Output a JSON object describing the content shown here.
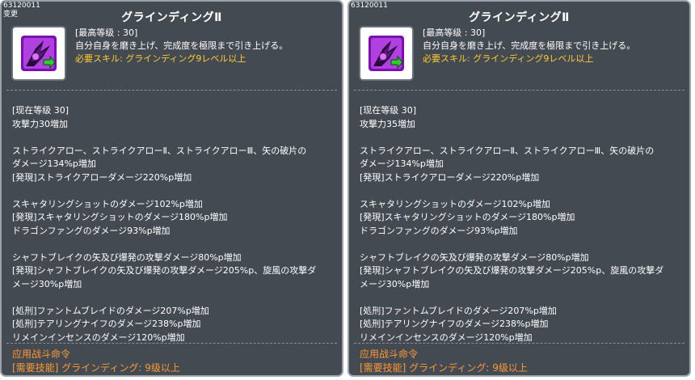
{
  "left": {
    "id": "63120011",
    "changed_label": "变更",
    "title": "グラインディングⅡ",
    "max_level": "[最高等级 : 30]",
    "description": "自分自身を磨き上げ、完成度を極限まで引き上げる。",
    "required_skill": "必要スキル: グラインディング9レベル以上",
    "lines": [
      "[现在等级 30]",
      "攻撃力30増加",
      "",
      "ストライクアロー、ストライクアローⅡ、ストライクアローⅢ、矢の破片の",
      "ダメージ134%p増加",
      "[発現]ストライクアローダメージ220%p増加",
      "",
      "スキャタリングショットのダメージ102%p増加",
      "[発現]スキャタリングショットのダメージ180%p増加",
      "ドラゴンファングのダメージ93%p増加",
      "",
      "シャフトブレイクの矢及び爆発の攻撃ダメージ80%p増加",
      "[発現]シャフトブレイクの矢及び爆発の攻撃ダメージ205%p、旋風の攻撃ダ",
      "メージ30%p増加",
      "",
      "[処刑]ファントムブレイドのダメージ207%p増加",
      "[処刑]テアリングナイフのダメージ238%p増加",
      "リメインインセンスのダメージ120%p増加"
    ],
    "footer_title": "应用战斗命令",
    "footer_req": "[需要技能] グラインディング: 9级以上"
  },
  "right": {
    "id": "63120011",
    "title": "グラインディングⅡ",
    "max_level": "[最高等级 : 30]",
    "description": "自分自身を磨き上げ、完成度を極限まで引き上げる。",
    "required_skill": "必要スキル: グラインディング9レベル以上",
    "lines": [
      "[现在等级 30]",
      "攻撃力35増加",
      "",
      "ストライクアロー、ストライクアローⅡ、ストライクアローⅢ、矢の破片の",
      "ダメージ134%p増加",
      "[発現]ストライクアローダメージ220%p増加",
      "",
      "スキャタリングショットのダメージ102%p増加",
      "[発現]スキャタリングショットのダメージ180%p増加",
      "ドラゴンファングのダメージ93%p増加",
      "",
      "シャフトブレイクの矢及び爆発の攻撃ダメージ80%p増加",
      "[発現]シャフトブレイクの矢及び爆発の攻撃ダメージ205%p、旋風の攻撃ダ",
      "メージ30%p増加",
      "",
      "[処刑]ファントムブレイドのダメージ207%p増加",
      "[処刑]テアリングナイフのダメージ238%p増加",
      "リメインインセンスのダメージ120%p増加"
    ],
    "footer_title": "应用战斗命令",
    "footer_req": "[需要技能] グラインディング: 9级以上"
  },
  "icon": {
    "name": "grinding-skill-icon",
    "primary_color": "#a020d0",
    "arrow_color": "#33cc33"
  },
  "colors": {
    "panel_bg": "#434a52",
    "required_text": "#ffcc33",
    "footer_text": "#ff9933"
  }
}
